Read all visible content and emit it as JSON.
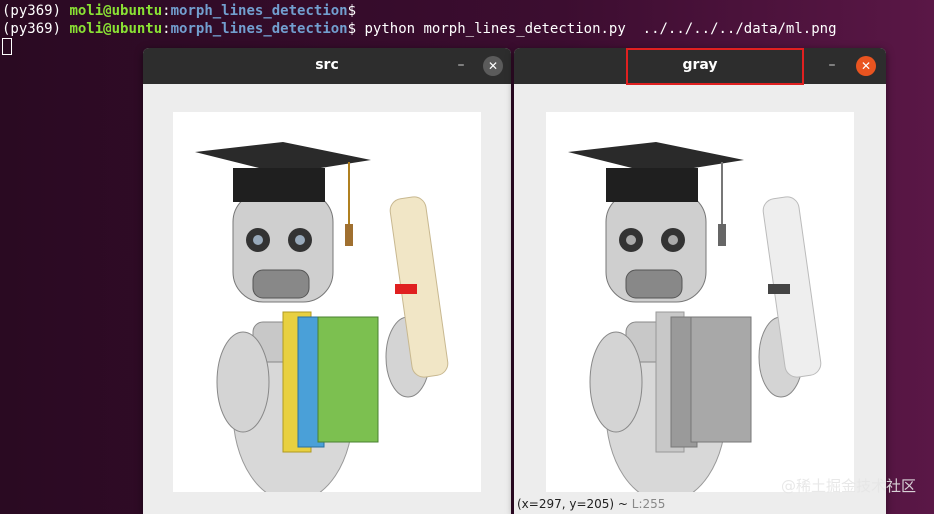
{
  "terminal": {
    "line1_env": "(py369)",
    "line1_user": "moli@ubuntu",
    "line1_sep": ":",
    "line1_path": "morph_lines_detection",
    "line1_prompt": "$",
    "line2_env": "(py369)",
    "line2_user": "moli@ubuntu",
    "line2_sep": ":",
    "line2_path": "morph_lines_detection",
    "line2_prompt": "$",
    "line2_command": " python morph_lines_detection.py  ../../../../data/ml.png"
  },
  "src_window": {
    "title": "src",
    "minimize": "–",
    "close": "✕"
  },
  "gray_window": {
    "title": "gray",
    "minimize": "–",
    "close": "✕",
    "status_coords": "(x=297, y=205) ~ ",
    "status_lum": "L:255"
  },
  "watermark": "@稀土掘金技术社区",
  "colors": {
    "ubuntu_orange": "#e95420",
    "highlight": "#e02020",
    "user_green": "#8ae234",
    "path_blue": "#729fcf"
  }
}
